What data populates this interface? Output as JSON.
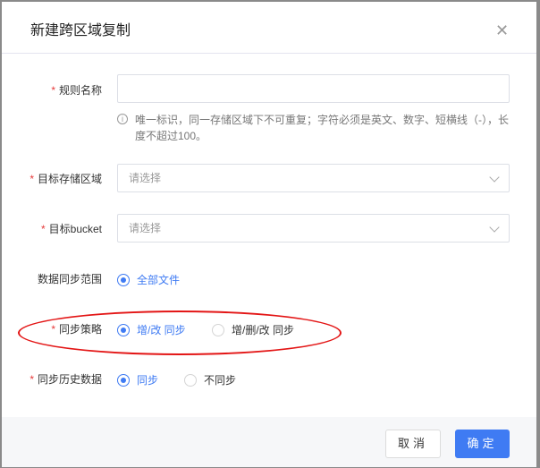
{
  "dialog": {
    "title": "新建跨区域复制",
    "close_icon": "close-icon"
  },
  "form": {
    "rule_name": {
      "label": "规则名称",
      "value": "",
      "help": "唯一标识，同一存储区域下不可重复；字符必须是英文、数字、短横线（-），长度不超过100。"
    },
    "target_region": {
      "label": "目标存储区域",
      "placeholder": "请选择"
    },
    "target_bucket": {
      "label": "目标bucket",
      "placeholder": "请选择"
    },
    "sync_scope": {
      "label": "数据同步范围",
      "options": [
        "全部文件"
      ],
      "selected": "全部文件"
    },
    "sync_policy": {
      "label": "同步策略",
      "options": [
        "增/改 同步",
        "增/删/改 同步"
      ],
      "selected": "增/改 同步"
    },
    "sync_history": {
      "label": "同步历史数据",
      "options": [
        "同步",
        "不同步"
      ],
      "selected": "同步"
    }
  },
  "footer": {
    "cancel": "取消",
    "confirm": "确定"
  },
  "colors": {
    "primary": "#3f7bf3",
    "required": "#e63b3b",
    "annotation": "#e31515"
  }
}
